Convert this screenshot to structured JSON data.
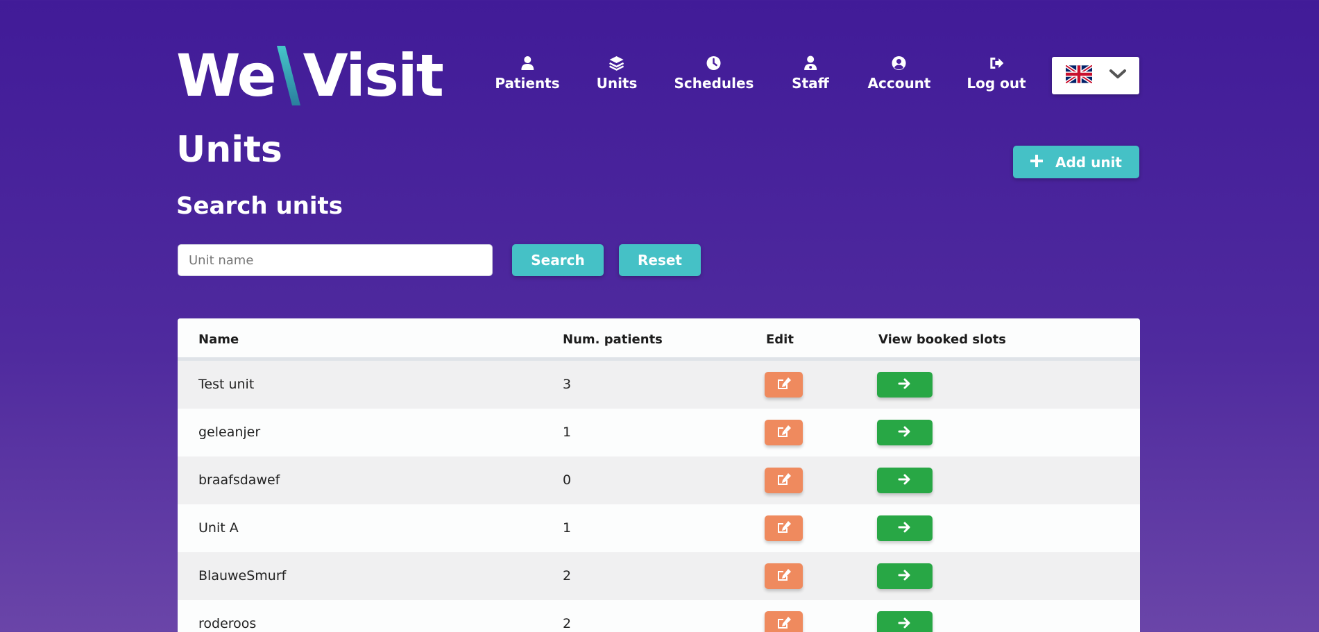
{
  "header": {
    "logo_part1": "We",
    "logo_part2": "Visit",
    "nav": [
      {
        "label": "Patients",
        "icon": "user-icon"
      },
      {
        "label": "Units",
        "icon": "layers-icon"
      },
      {
        "label": "Schedules",
        "icon": "clock-icon"
      },
      {
        "label": "Staff",
        "icon": "staff-icon"
      },
      {
        "label": "Account",
        "icon": "account-circle-icon"
      },
      {
        "label": "Log out",
        "icon": "sign-out-icon"
      }
    ],
    "language": {
      "selected": "English",
      "flag_icon": "uk-flag-icon"
    }
  },
  "page": {
    "title": "Units",
    "add_button_label": "Add unit",
    "search_title": "Search units",
    "search_placeholder": "Unit name",
    "search_value": "",
    "search_button": "Search",
    "reset_button": "Reset"
  },
  "table": {
    "columns": [
      "Name",
      "Num. patients",
      "Edit",
      "View booked slots"
    ],
    "rows": [
      {
        "name": "Test unit",
        "patients": "3"
      },
      {
        "name": "geleanjer",
        "patients": "1"
      },
      {
        "name": "braafsdawef",
        "patients": "0"
      },
      {
        "name": "Unit A",
        "patients": "1"
      },
      {
        "name": "BlauweSmurf",
        "patients": "2"
      },
      {
        "name": "roderoos",
        "patients": "2"
      }
    ]
  },
  "colors": {
    "background_top": "#411b98",
    "accent_teal": "#45c1c6",
    "edit_orange": "#ef8a5e",
    "view_green": "#28a745"
  }
}
